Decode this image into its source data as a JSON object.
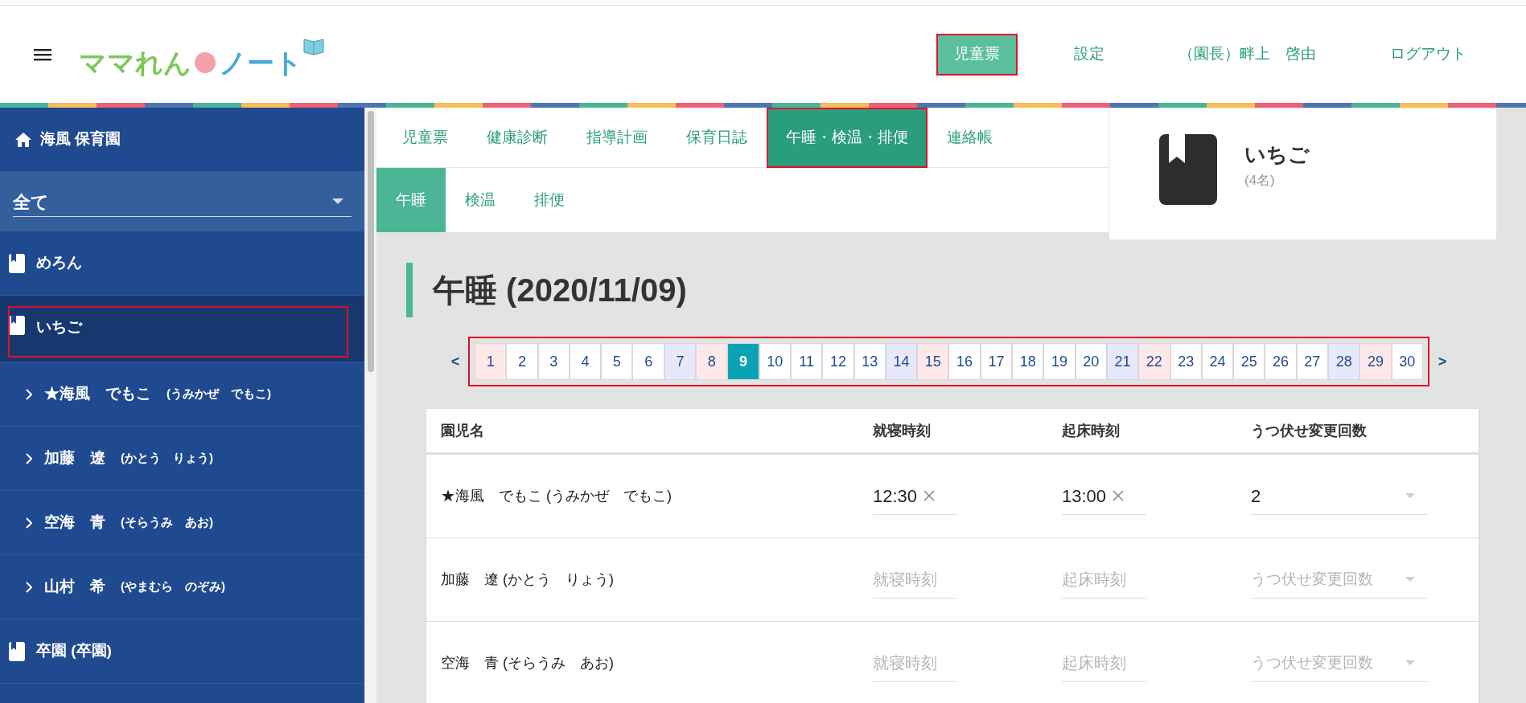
{
  "header": {
    "logo": {
      "text_1": "ママれん",
      "text_2": "ノート"
    },
    "nav": [
      {
        "label": "児童票",
        "selected": true,
        "highlighted": true
      },
      {
        "label": "設定",
        "selected": false,
        "highlighted": false
      },
      {
        "label": "（園長）畔上　啓由",
        "selected": false,
        "highlighted": false
      },
      {
        "label": "ログアウト",
        "selected": false,
        "highlighted": false
      }
    ]
  },
  "sidebar": {
    "title": "海風 保育園",
    "filter": {
      "value": "全て"
    },
    "items": [
      {
        "label": "めろん",
        "selected": false,
        "highlighted": false
      },
      {
        "label": "いちご",
        "selected": true,
        "highlighted": true,
        "children": [
          {
            "name": "★海風　でもこ",
            "reading": "(うみかぜ　でもこ)"
          },
          {
            "name": "加藤　遼",
            "reading": "(かとう　りょう)"
          },
          {
            "name": "空海　青",
            "reading": "(そらうみ　あお)"
          },
          {
            "name": "山村　希",
            "reading": "(やまむら　のぞみ)"
          }
        ]
      },
      {
        "label": "卒園 (卒園)",
        "selected": false,
        "highlighted": false
      }
    ]
  },
  "tabs": [
    {
      "label": "児童票",
      "selected": false,
      "highlighted": false
    },
    {
      "label": "健康診断",
      "selected": false,
      "highlighted": false
    },
    {
      "label": "指導計画",
      "selected": false,
      "highlighted": false
    },
    {
      "label": "保育日誌",
      "selected": false,
      "highlighted": false
    },
    {
      "label": "午睡・検温・排便",
      "selected": true,
      "highlighted": true
    },
    {
      "label": "連絡帳",
      "selected": false,
      "highlighted": false
    }
  ],
  "subtabs": [
    {
      "label": "午睡",
      "selected": true
    },
    {
      "label": "検温",
      "selected": false
    },
    {
      "label": "排便",
      "selected": false
    }
  ],
  "class_card": {
    "name": "いちご",
    "count": "(4名)"
  },
  "page_title": "午睡 (2020/11/09)",
  "calendar": {
    "prev": "<",
    "next": ">",
    "highlighted": true,
    "days": [
      {
        "label": "1",
        "kind": "sunday",
        "selected": false
      },
      {
        "label": "2",
        "kind": "weekday",
        "selected": false
      },
      {
        "label": "3",
        "kind": "weekday",
        "selected": false
      },
      {
        "label": "4",
        "kind": "weekday",
        "selected": false
      },
      {
        "label": "5",
        "kind": "weekday",
        "selected": false
      },
      {
        "label": "6",
        "kind": "weekday",
        "selected": false
      },
      {
        "label": "7",
        "kind": "saturday",
        "selected": false
      },
      {
        "label": "8",
        "kind": "sunday",
        "selected": false
      },
      {
        "label": "9",
        "kind": "weekday",
        "selected": true
      },
      {
        "label": "10",
        "kind": "weekday",
        "selected": false
      },
      {
        "label": "11",
        "kind": "weekday",
        "selected": false
      },
      {
        "label": "12",
        "kind": "weekday",
        "selected": false
      },
      {
        "label": "13",
        "kind": "weekday",
        "selected": false
      },
      {
        "label": "14",
        "kind": "saturday",
        "selected": false
      },
      {
        "label": "15",
        "kind": "sunday",
        "selected": false
      },
      {
        "label": "16",
        "kind": "weekday",
        "selected": false
      },
      {
        "label": "17",
        "kind": "weekday",
        "selected": false
      },
      {
        "label": "18",
        "kind": "weekday",
        "selected": false
      },
      {
        "label": "19",
        "kind": "weekday",
        "selected": false
      },
      {
        "label": "20",
        "kind": "weekday",
        "selected": false
      },
      {
        "label": "21",
        "kind": "saturday",
        "selected": false
      },
      {
        "label": "22",
        "kind": "sunday",
        "selected": false
      },
      {
        "label": "23",
        "kind": "weekday",
        "selected": false
      },
      {
        "label": "24",
        "kind": "weekday",
        "selected": false
      },
      {
        "label": "25",
        "kind": "weekday",
        "selected": false
      },
      {
        "label": "26",
        "kind": "weekday",
        "selected": false
      },
      {
        "label": "27",
        "kind": "weekday",
        "selected": false
      },
      {
        "label": "28",
        "kind": "saturday",
        "selected": false
      },
      {
        "label": "29",
        "kind": "sunday",
        "selected": false
      },
      {
        "label": "30",
        "kind": "weekday",
        "selected": false
      }
    ]
  },
  "table": {
    "columns": [
      "園児名",
      "就寝時刻",
      "起床時刻",
      "うつ伏せ変更回数"
    ],
    "rows": [
      {
        "name": "★海風　でもこ (うみかぜ　でもこ)",
        "bedtime": {
          "value": "12:30"
        },
        "wake_time": {
          "value": "13:00"
        },
        "prone_count": {
          "value": "2"
        }
      },
      {
        "name": "加藤　遼 (かとう　りょう)",
        "bedtime": {
          "placeholder": "就寝時刻"
        },
        "wake_time": {
          "placeholder": "起床時刻"
        },
        "prone_count": {
          "placeholder": "うつ伏せ変更回数"
        }
      },
      {
        "name": "空海　青 (そらうみ　あお)",
        "bedtime": {
          "placeholder": "就寝時刻"
        },
        "wake_time": {
          "placeholder": "起床時刻"
        },
        "prone_count": {
          "placeholder": "うつ伏せ変更回数"
        }
      }
    ]
  }
}
